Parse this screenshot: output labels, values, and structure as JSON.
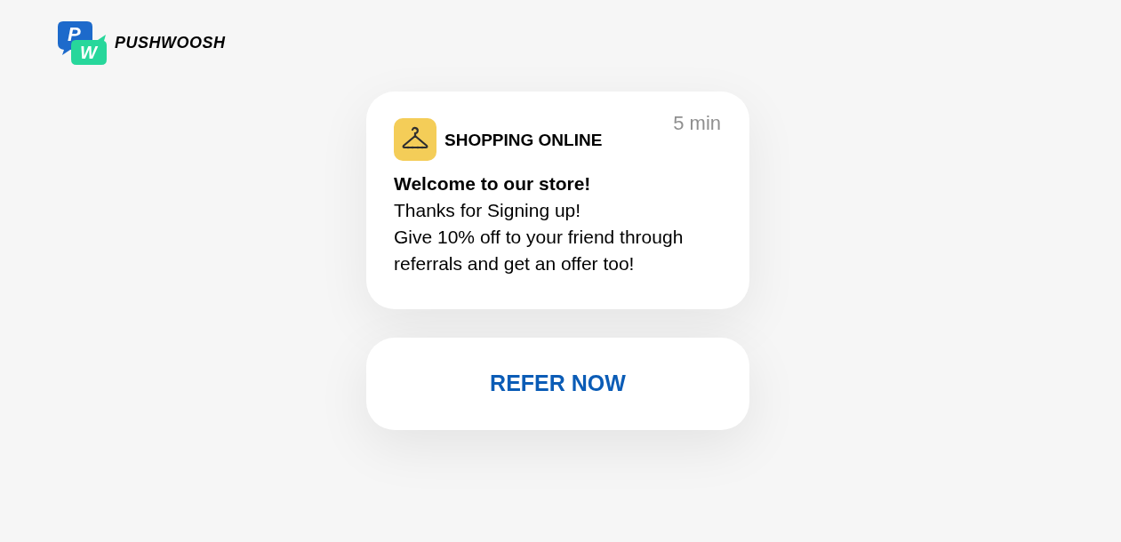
{
  "brand": {
    "mark_letters": [
      "P",
      "W"
    ],
    "name": "PUSHWOOSH"
  },
  "notification": {
    "app_name": "SHOPPING ONLINE",
    "time": "5 min",
    "title": "Welcome to our store!",
    "body": [
      "Thanks for Signing up!",
      "Give 10% off to your friend through referrals and get an offer too!"
    ]
  },
  "action": {
    "label": "REFER NOW"
  }
}
